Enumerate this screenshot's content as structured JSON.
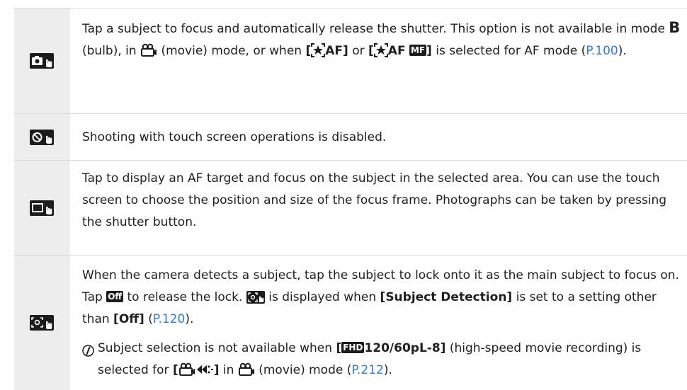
{
  "rows": [
    {
      "icon": "camera-touch-icon",
      "t1": "Tap a subject to focus and automatically release the shutter. This option is not available in mode ",
      "t2": "B",
      "t3": " (bulb), in ",
      "t4": " (movie) mode, or when ",
      "t5": "[",
      "t6": "AF]",
      "t7": " or ",
      "t8": "[",
      "t9": "AF",
      "t10": "MF",
      "t11": "]",
      "t12": " is selected for AF mode (",
      "link": "P.100",
      "t13": ")."
    },
    {
      "icon": "touch-disabled-icon",
      "text": "Shooting with touch screen operations is disabled."
    },
    {
      "icon": "af-frame-touch-icon",
      "text": "Tap to display an AF target and focus on the subject in the selected area. You can use the touch screen to choose the position and size of the focus frame. Photographs can be taken by pressing the shutter button."
    },
    {
      "icon": "subject-lock-touch-icon",
      "t1": "When the camera detects a subject, tap the subject to lock onto it as the main subject to focus on. Tap ",
      "off_chip": "Off",
      "t2": " to release the lock. ",
      "t3": " is displayed when ",
      "b1": "[Subject Detection]",
      "t4": " is set to a setting other than ",
      "b2": "[Off]",
      "t5": " (",
      "link1": "P.120",
      "t6": ").",
      "n1": "Subject selection is not available when ",
      "n_chip": "FHD",
      "n_b1": "120/60pL-8]",
      "n2": " (high-speed movie recording) is selected for ",
      "n_b2_open": "[",
      "n_b2_close": "]",
      "n3": " in ",
      "n4": " (movie) mode (",
      "link2": "P.212",
      "n5": ")."
    }
  ]
}
